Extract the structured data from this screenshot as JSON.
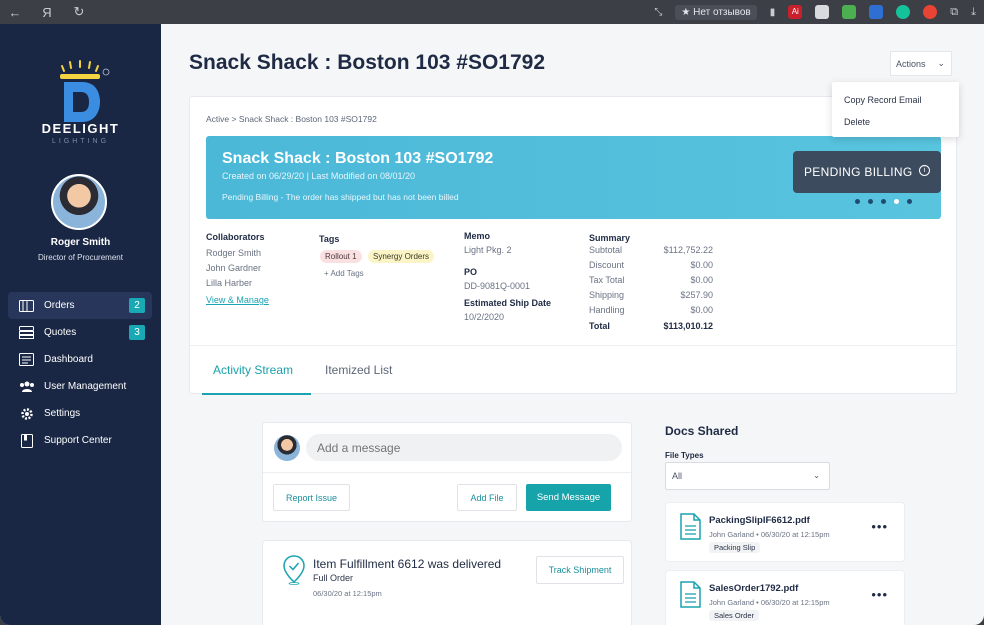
{
  "browser": {
    "reviews_label": "★ Нет отзывов",
    "ya_label": "Я",
    "ext_label": "Ai"
  },
  "brand": {
    "name": "DEELIGHT",
    "sub": "LIGHTING"
  },
  "user": {
    "name": "Roger Smith",
    "role": "Director of Procurement"
  },
  "sidebar": {
    "items": [
      {
        "label": "Orders",
        "badge": "2",
        "icon": "orders-icon"
      },
      {
        "label": "Quotes",
        "badge": "3",
        "icon": "quotes-icon"
      },
      {
        "label": "Dashboard",
        "icon": "dashboard-icon"
      },
      {
        "label": "User Management",
        "icon": "users-icon"
      },
      {
        "label": "Settings",
        "icon": "gear-icon"
      },
      {
        "label": "Support Center",
        "icon": "book-icon"
      }
    ]
  },
  "header": {
    "title": "Snack Shack : Boston 103 #SO1792",
    "actions_label": "Actions",
    "actions_menu": [
      "Copy Record Email",
      "Delete"
    ]
  },
  "order": {
    "breadcrumb": "Active > Snack Shack : Boston 103 #SO1792",
    "banner_title": "Snack Shack : Boston 103 #SO1792",
    "banner_meta": "Created on 06/29/20 | Last Modified on 08/01/20",
    "banner_status": "Pending Billing - The order has shipped but has not been billed",
    "status_label": "PENDING BILLING",
    "collaborators_title": "Collaborators",
    "collaborators": [
      "Rodger Smith",
      "John Gardner",
      "Lilla Harber"
    ],
    "view_manage": "View & Manage",
    "tags_title": "Tags",
    "tags": [
      "Rollout 1",
      "Synergy Orders"
    ],
    "add_tags": "+ Add Tags",
    "memo_title": "Memo",
    "memo": "Light Pkg. 2",
    "po_title": "PO",
    "po": "DD-9081Q-0001",
    "ship_title": "Estimated Ship Date",
    "ship_date": "10/2/2020",
    "summary_title": "Summary",
    "summary": [
      {
        "label": "Subtotal",
        "value": "$112,752.22"
      },
      {
        "label": "Discount",
        "value": "$0.00"
      },
      {
        "label": "Tax Total",
        "value": "$0.00"
      },
      {
        "label": "Shipping",
        "value": "$257.90"
      },
      {
        "label": "Handling",
        "value": "$0.00"
      },
      {
        "label": "Total",
        "value": "$113,010.12"
      }
    ]
  },
  "tabs": [
    "Activity Stream",
    "Itemized List"
  ],
  "message": {
    "placeholder": "Add a message",
    "report_issue": "Report Issue",
    "add_file": "Add File",
    "send": "Send Message"
  },
  "activity": {
    "title": "Item Fulfillment 6612 was delivered",
    "sub": "Full Order",
    "date": "06/30/20 at 12:15pm",
    "track": "Track Shipment"
  },
  "docs": {
    "title": "Docs Shared",
    "file_types_label": "File Types",
    "file_type_value": "All",
    "items": [
      {
        "name": "PackingSlipIF6612.pdf",
        "meta": "John Garland • 06/30/20 at 12:15pm",
        "tag": "Packing Slip"
      },
      {
        "name": "SalesOrder1792.pdf",
        "meta": "John Garland • 06/30/20 at 12:15pm",
        "tag": "Sales Order"
      }
    ]
  },
  "colors": {
    "sidebar": "#1a2744",
    "accent": "#17a3aa",
    "banner": "#4cb8d8",
    "pending": "#3c4b5e"
  }
}
